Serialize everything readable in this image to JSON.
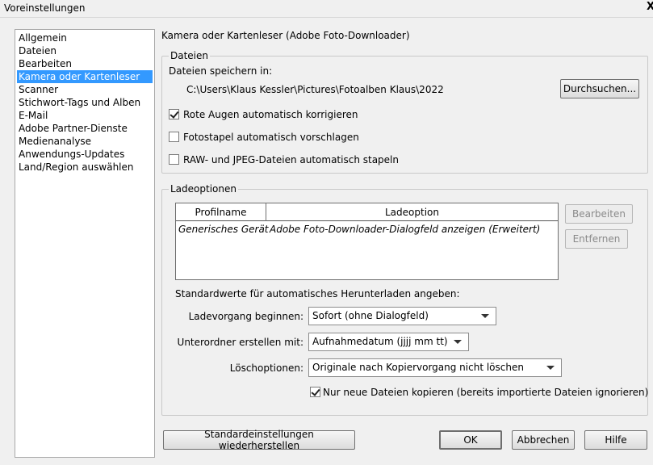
{
  "window": {
    "title": "Voreinstellungen",
    "close_label": "X"
  },
  "sidebar": {
    "items": [
      {
        "label": "Allgemein"
      },
      {
        "label": "Dateien"
      },
      {
        "label": "Bearbeiten"
      },
      {
        "label": "Kamera oder Kartenleser",
        "selected": true
      },
      {
        "label": "Scanner"
      },
      {
        "label": "Stichwort-Tags und Alben"
      },
      {
        "label": "E-Mail"
      },
      {
        "label": "Adobe Partner-Dienste"
      },
      {
        "label": "Medienanalyse"
      },
      {
        "label": "Anwendungs-Updates"
      },
      {
        "label": "Land/Region auswählen"
      }
    ]
  },
  "main": {
    "heading": "Kamera oder Kartenleser (Adobe Foto-Downloader)",
    "files": {
      "legend": "Dateien",
      "save_label": "Dateien speichern in:",
      "path": "C:\\Users\\Klaus Kessler\\Pictures\\Fotoalben Klaus\\2022",
      "browse_label": "Durchsuchen...",
      "opt_redeye": {
        "label": "Rote Augen automatisch korrigieren",
        "checked": true
      },
      "opt_stack": {
        "label": "Fotostapel automatisch vorschlagen",
        "checked": false
      },
      "opt_rawjpeg": {
        "label": "RAW- und JPEG-Dateien automatisch stapeln",
        "checked": false
      }
    },
    "load": {
      "legend": "Ladeoptionen",
      "table": {
        "headers": [
          "Profilname",
          "Ladeoption"
        ],
        "rows": [
          [
            "Generisches Gerät",
            "Adobe Foto-Downloader-Dialogfeld anzeigen (Erweitert)"
          ]
        ]
      },
      "edit_label": "Bearbeiten",
      "remove_label": "Entfernen",
      "defaults_label": "Standardwerte für automatisches Herunterladen angeben:",
      "begin_label": "Ladevorgang beginnen:",
      "begin_value": "Sofort (ohne Dialogfeld)",
      "subfolder_label": "Unterordner erstellen mit:",
      "subfolder_value": "Aufnahmedatum (jjjj mm tt)",
      "delete_label": "Löschoptionen:",
      "delete_value": "Originale nach Kopiervorgang nicht löschen",
      "copy_new_only": {
        "label": "Nur neue Dateien kopieren (bereits importierte Dateien ignorieren)",
        "checked": true
      }
    }
  },
  "footer": {
    "restore_label": "Standardeinstellungen wiederherstellen",
    "ok_label": "OK",
    "cancel_label": "Abbrechen",
    "help_label": "Hilfe"
  },
  "colors": {
    "selection": "#3399ff",
    "background": "#f0f0f0"
  }
}
